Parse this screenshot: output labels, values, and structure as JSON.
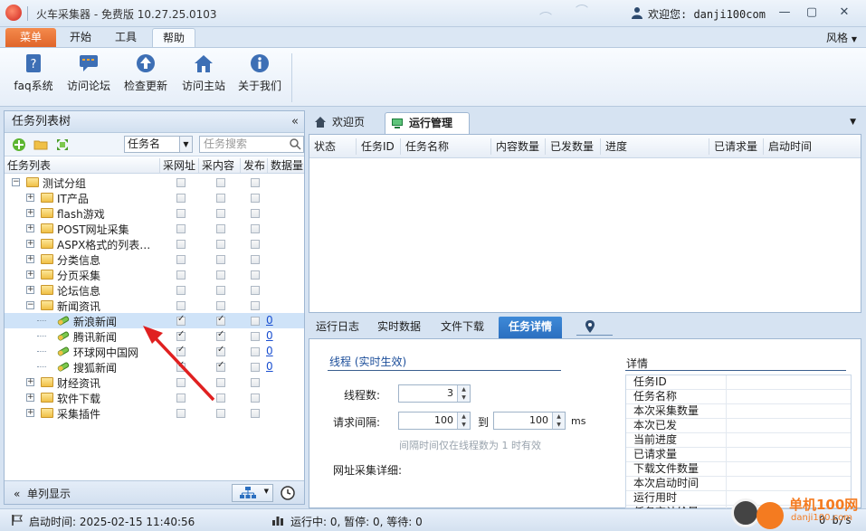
{
  "window": {
    "title": "火车采集器 - 免费版 10.27.25.0103",
    "welcome": "欢迎您: danji100com",
    "controls": {
      "minimize": "—",
      "restore": "▢",
      "close": "✕"
    }
  },
  "menubar": {
    "tabs": [
      "菜单",
      "开始",
      "工具",
      "帮助"
    ],
    "style_label": "风格"
  },
  "ribbon": {
    "buttons": [
      {
        "label": "faq系统",
        "icon": "faq-icon"
      },
      {
        "label": "访问论坛",
        "icon": "forum-icon"
      },
      {
        "label": "检查更新",
        "icon": "update-icon"
      },
      {
        "label": "访问主站",
        "icon": "home-icon"
      },
      {
        "label": "关于我们",
        "icon": "info-icon"
      }
    ]
  },
  "left_panel": {
    "title": "任务列表树",
    "collapse": "«",
    "select_value": "任务名",
    "search_placeholder": "任务搜索",
    "columns": [
      "任务列表",
      "采网址",
      "采内容",
      "发布",
      "数据量"
    ],
    "tree": [
      {
        "label": "测试分组",
        "level": 0,
        "type": "group",
        "expanded": true
      },
      {
        "label": "IT产品",
        "level": 1,
        "type": "folder"
      },
      {
        "label": "flash游戏",
        "level": 1,
        "type": "folder"
      },
      {
        "label": "POST网址采集",
        "level": 1,
        "type": "folder"
      },
      {
        "label": "ASPX格式的列表…",
        "level": 1,
        "type": "folder"
      },
      {
        "label": "分类信息",
        "level": 1,
        "type": "folder"
      },
      {
        "label": "分页采集",
        "level": 1,
        "type": "folder"
      },
      {
        "label": "论坛信息",
        "level": 1,
        "type": "folder"
      },
      {
        "label": "新闻资讯",
        "level": 1,
        "type": "folder",
        "expanded": true
      },
      {
        "label": "新浪新闻",
        "level": 2,
        "type": "task",
        "url": true,
        "content": true,
        "publish": false,
        "count": "0",
        "selected": true
      },
      {
        "label": "腾讯新闻",
        "level": 2,
        "type": "task",
        "url": true,
        "content": true,
        "publish": false,
        "count": "0"
      },
      {
        "label": "环球网中国网",
        "level": 2,
        "type": "task",
        "url": true,
        "content": true,
        "publish": false,
        "count": "0"
      },
      {
        "label": "搜狐新闻",
        "level": 2,
        "type": "task",
        "url": true,
        "content": true,
        "publish": false,
        "count": "0"
      },
      {
        "label": "财经资讯",
        "level": 1,
        "type": "folder"
      },
      {
        "label": "软件下载",
        "level": 1,
        "type": "folder"
      },
      {
        "label": "采集插件",
        "level": 1,
        "type": "folder"
      }
    ],
    "footer_label": "单列显示"
  },
  "right_tabs": [
    "欢迎页",
    "运行管理"
  ],
  "grid_columns": [
    "状态",
    "任务ID",
    "任务名称",
    "内容数量",
    "已发数量",
    "进度",
    "已请求量",
    "启动时间"
  ],
  "bottom_tabs": [
    "运行日志",
    "实时数据",
    "文件下载",
    "任务详情"
  ],
  "thread_section": {
    "title": "线程  (实时生效)",
    "thread_label": "线程数:",
    "thread_value": "3",
    "interval_label": "请求间隔:",
    "interval_from": "100",
    "to_label": "到",
    "interval_to": "100",
    "unit": "ms",
    "hint": "间隔时间仅在线程数为 1 时有效",
    "url_detail_label": "网址采集详细:"
  },
  "details": {
    "title": "详情",
    "rows": [
      "任务ID",
      "任务名称",
      "本次采集数量",
      "本次已发",
      "当前进度",
      "已请求量",
      "下载文件数量",
      "本次启动时间",
      "运行用时",
      "任务交计给量"
    ]
  },
  "statusbar": {
    "start_time": "启动时间: 2025-02-15 11:40:56",
    "run_stats": "运行中: 0, 暂停: 0, 等待: 0",
    "speed": "0 b/s"
  },
  "watermark": {
    "text": "单机100网",
    "url": "danji100.com"
  },
  "colors": {
    "accent_orange": "#e0652a",
    "selected_tab_blue": "#2b6fc0",
    "selected_row": "#cfe3f8"
  }
}
